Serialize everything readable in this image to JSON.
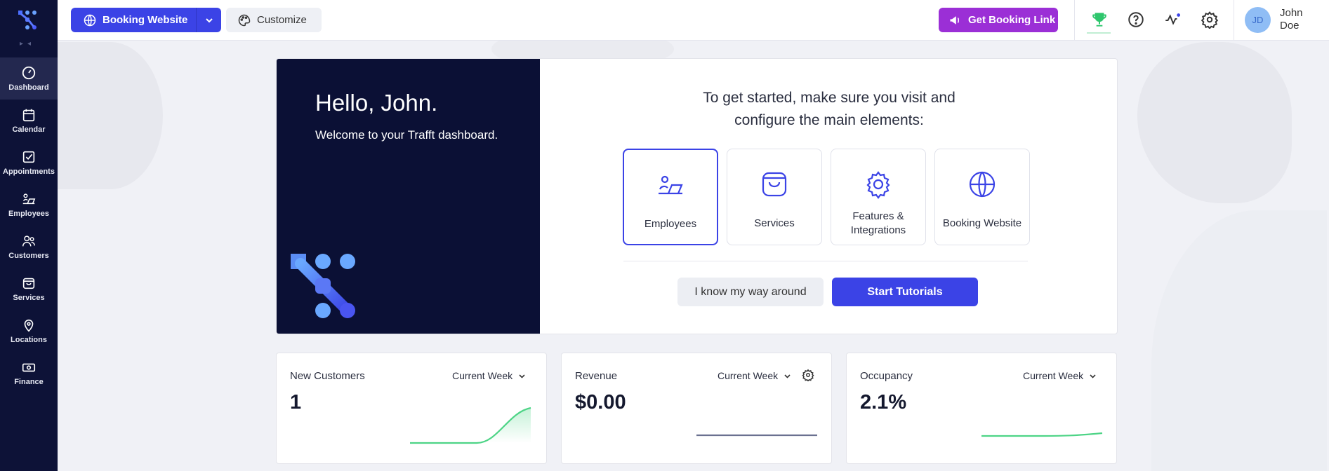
{
  "app": {
    "brand_color": "#3b43e6",
    "sidebar_bg": "#0d1237"
  },
  "sidebar": {
    "items": [
      {
        "label": "Dashboard",
        "icon": "gauge-icon",
        "active": true
      },
      {
        "label": "Calendar",
        "icon": "calendar-icon"
      },
      {
        "label": "Appointments",
        "icon": "checkbox-icon"
      },
      {
        "label": "Employees",
        "icon": "employee-laptop-icon"
      },
      {
        "label": "Customers",
        "icon": "users-icon"
      },
      {
        "label": "Services",
        "icon": "shopping-bag-icon"
      },
      {
        "label": "Locations",
        "icon": "map-pin-icon"
      },
      {
        "label": "Finance",
        "icon": "banknote-icon"
      }
    ]
  },
  "topbar": {
    "booking_website": "Booking Website",
    "customize": "Customize",
    "get_booking_link": "Get Booking Link",
    "icons": [
      "trophy-icon",
      "help-icon",
      "activity-icon",
      "settings-icon"
    ],
    "user": {
      "initials": "JD",
      "name": "John Doe"
    }
  },
  "hero": {
    "title": "Hello, John.",
    "subtitle": "Welcome to your Trafft dashboard.",
    "intro": "To get started, make sure you visit and configure the main elements:",
    "tiles": [
      {
        "label": "Employees",
        "icon": "employee-laptop-icon",
        "active": true
      },
      {
        "label": "Services",
        "icon": "shopping-bag-icon"
      },
      {
        "label": "Features & Integrations",
        "icon": "gear-icon"
      },
      {
        "label": "Booking Website",
        "icon": "globe-icon"
      }
    ],
    "know_way": "I know my way around",
    "start_tutorials": "Start Tutorials"
  },
  "stats": [
    {
      "title": "New Customers",
      "period": "Current Week",
      "value": "1"
    },
    {
      "title": "Revenue",
      "period": "Current Week",
      "value": "$0.00"
    },
    {
      "title": "Occupancy",
      "period": "Current Week",
      "value": "2.1%"
    }
  ]
}
